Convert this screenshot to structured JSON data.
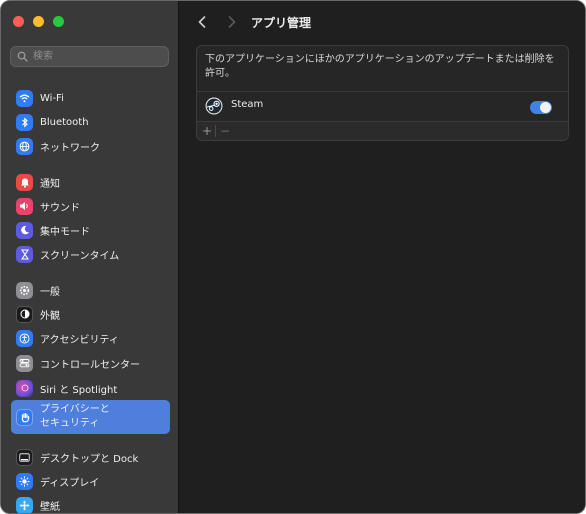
{
  "sidebar": {
    "search_placeholder": "検索",
    "items": [
      {
        "label": "Wi-Fi",
        "icon": "wifi-icon",
        "color": "#2f7cf6"
      },
      {
        "label": "Bluetooth",
        "icon": "bluetooth-icon",
        "color": "#2f7cf6"
      },
      {
        "label": "ネットワーク",
        "icon": "globe-icon",
        "color": "#2f7cf6"
      },
      {
        "label": "通知",
        "icon": "bell-icon",
        "color": "#ea4a45"
      },
      {
        "label": "サウンド",
        "icon": "speaker-icon",
        "color": "#e9436b"
      },
      {
        "label": "集中モード",
        "icon": "moon-icon",
        "color": "#5d5be0"
      },
      {
        "label": "スクリーンタイム",
        "icon": "hourglass-icon",
        "color": "#5d5be0"
      },
      {
        "label": "一般",
        "icon": "gear-icon",
        "color": "#8e8e93"
      },
      {
        "label": "外観",
        "icon": "appearance-icon",
        "color": "#1c1c1e"
      },
      {
        "label": "アクセシビリティ",
        "icon": "accessibility-icon",
        "color": "#2f7cf6"
      },
      {
        "label": "コントロールセンター",
        "icon": "control-center-icon",
        "color": "#8e8e93"
      },
      {
        "label": "Siri と Spotlight",
        "icon": "siri-icon",
        "color": "#6a4fd8"
      },
      {
        "label": "プライバシーと\nセキュリティ",
        "icon": "hand-icon",
        "color": "#2f7cf6"
      },
      {
        "label": "デスクトップと Dock",
        "icon": "dock-icon",
        "color": "#1c1c1e"
      },
      {
        "label": "ディスプレイ",
        "icon": "sun-icon",
        "color": "#2f7cf6"
      },
      {
        "label": "壁紙",
        "icon": "wallpaper-icon",
        "color": "#36a8f0"
      }
    ],
    "selected_index": 12
  },
  "header": {
    "title": "アプリ管理",
    "back_icon": "chevron-left-icon",
    "forward_icon": "chevron-right-icon"
  },
  "panel": {
    "description": "下のアプリケーションにほかのアプリケーションのアップデートまたは削除を許可。",
    "apps": [
      {
        "name": "Steam",
        "icon": "steam-icon",
        "enabled": true
      }
    ],
    "add_label": "+",
    "remove_label": "−"
  },
  "colors": {
    "accent": "#4f7fdc",
    "toggle_on": "#3f84e5",
    "sidebar_bg": "#393939",
    "main_bg": "#1f1f1f"
  }
}
